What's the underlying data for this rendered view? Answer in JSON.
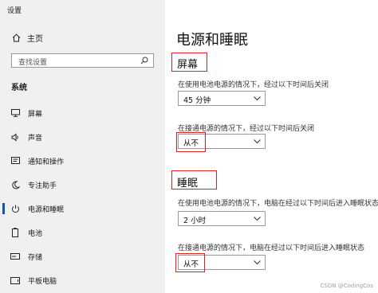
{
  "window": {
    "title": "设置"
  },
  "sidebar": {
    "home_label": "主页",
    "search_placeholder": "查找设置",
    "group_label": "系统",
    "items": [
      {
        "label": "屏幕",
        "icon": "monitor-icon"
      },
      {
        "label": "声音",
        "icon": "speaker-icon"
      },
      {
        "label": "通知和操作",
        "icon": "notification-icon"
      },
      {
        "label": "专注助手",
        "icon": "moon-icon"
      },
      {
        "label": "电源和睡眠",
        "icon": "power-icon",
        "active": true
      },
      {
        "label": "电池",
        "icon": "battery-icon"
      },
      {
        "label": "存储",
        "icon": "storage-icon"
      },
      {
        "label": "平板电脑",
        "icon": "tablet-icon"
      }
    ]
  },
  "main": {
    "title": "电源和睡眠",
    "screen_section": {
      "heading": "屏幕",
      "battery_label": "在使用电池电源的情况下，经过以下时间后关闭",
      "battery_value": "45 分钟",
      "plugged_label": "在接通电源的情况下，经过以下时间后关闭",
      "plugged_value": "从不"
    },
    "sleep_section": {
      "heading": "睡眠",
      "battery_label": "在使用电池电源的情况下，电脑在经过以下时间后进入睡眠状态",
      "battery_value": "2 小时",
      "plugged_label": "在接通电源的情况下，电脑在经过以下时间后进入睡眠状态",
      "plugged_value": "从不"
    }
  },
  "watermark": "CSDN @CodingCos",
  "colors": {
    "accent": "#0a59b8",
    "highlight": "#e02020",
    "sidebar_bg": "#f0f0f0"
  }
}
